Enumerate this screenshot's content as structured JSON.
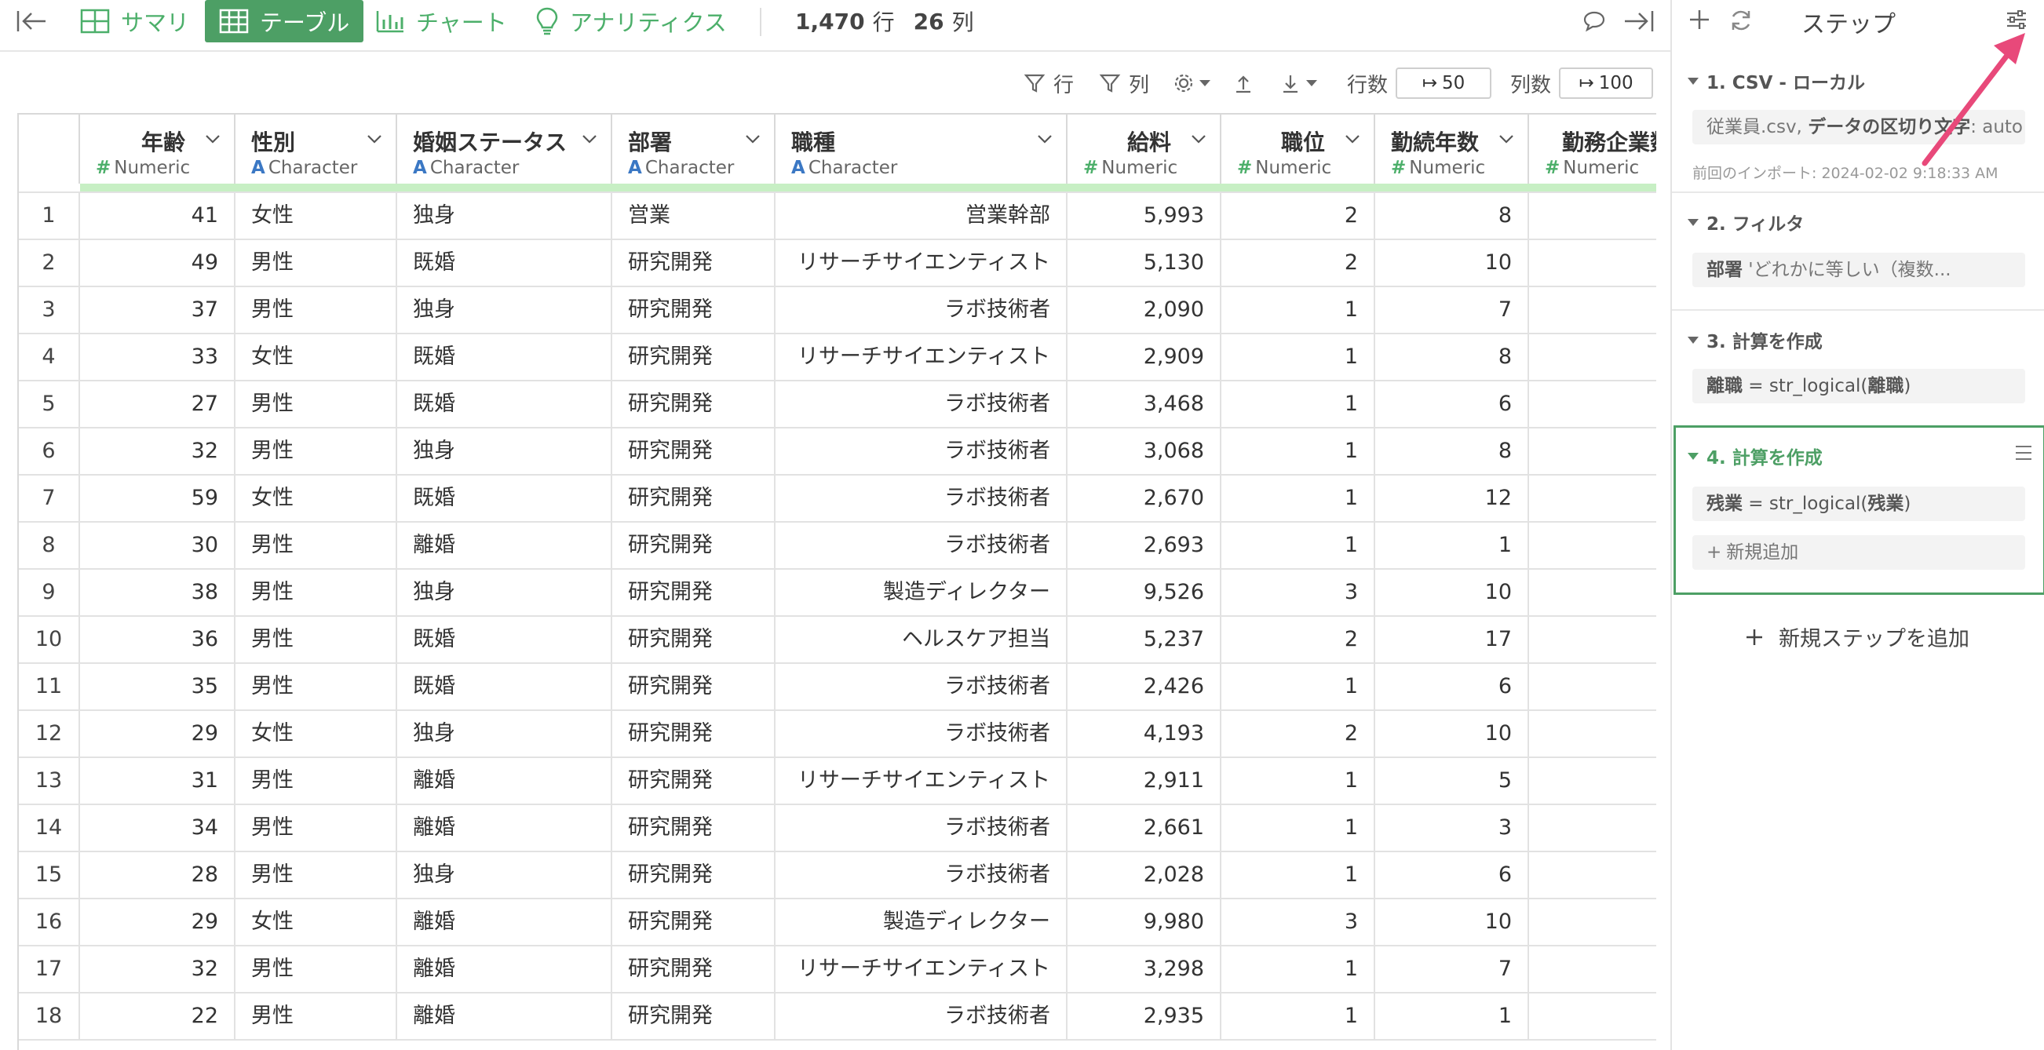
{
  "toolbar": {
    "tabs": [
      {
        "label": "サマリ",
        "icon": "summary-grid-icon",
        "active": false
      },
      {
        "label": "テーブル",
        "icon": "table-icon",
        "active": true
      },
      {
        "label": "チャート",
        "icon": "bar-chart-icon",
        "active": false
      },
      {
        "label": "アナリティクス",
        "icon": "lightbulb-icon",
        "active": false
      }
    ],
    "row_count": "1,470",
    "row_unit": "行",
    "col_count": "26",
    "col_unit": "列"
  },
  "options": {
    "row_filter": "行",
    "col_filter": "列",
    "rows_label": "行数",
    "rows_value": "50",
    "cols_label": "列数",
    "cols_value": "100"
  },
  "table": {
    "columns": [
      {
        "name": "年齢",
        "type": "Numeric"
      },
      {
        "name": "性別",
        "type": "Character"
      },
      {
        "name": "婚姻ステータス",
        "type": "Character"
      },
      {
        "name": "部署",
        "type": "Character"
      },
      {
        "name": "職種",
        "type": "Character"
      },
      {
        "name": "給料",
        "type": "Numeric"
      },
      {
        "name": "職位",
        "type": "Numeric"
      },
      {
        "name": "勤続年数",
        "type": "Numeric"
      },
      {
        "name": "勤務企業数",
        "type": "Numeric"
      }
    ],
    "rows": [
      [
        "1",
        "41",
        "女性",
        "独身",
        "営業",
        "営業幹部",
        "5,993",
        "2",
        "8"
      ],
      [
        "2",
        "49",
        "男性",
        "既婚",
        "研究開発",
        "リサーチサイエンティスト",
        "5,130",
        "2",
        "10"
      ],
      [
        "3",
        "37",
        "男性",
        "独身",
        "研究開発",
        "ラボ技術者",
        "2,090",
        "1",
        "7"
      ],
      [
        "4",
        "33",
        "女性",
        "既婚",
        "研究開発",
        "リサーチサイエンティスト",
        "2,909",
        "1",
        "8"
      ],
      [
        "5",
        "27",
        "男性",
        "既婚",
        "研究開発",
        "ラボ技術者",
        "3,468",
        "1",
        "6"
      ],
      [
        "6",
        "32",
        "男性",
        "独身",
        "研究開発",
        "ラボ技術者",
        "3,068",
        "1",
        "8"
      ],
      [
        "7",
        "59",
        "女性",
        "既婚",
        "研究開発",
        "ラボ技術者",
        "2,670",
        "1",
        "12"
      ],
      [
        "8",
        "30",
        "男性",
        "離婚",
        "研究開発",
        "ラボ技術者",
        "2,693",
        "1",
        "1"
      ],
      [
        "9",
        "38",
        "男性",
        "独身",
        "研究開発",
        "製造ディレクター",
        "9,526",
        "3",
        "10"
      ],
      [
        "10",
        "36",
        "男性",
        "既婚",
        "研究開発",
        "ヘルスケア担当",
        "5,237",
        "2",
        "17"
      ],
      [
        "11",
        "35",
        "男性",
        "既婚",
        "研究開発",
        "ラボ技術者",
        "2,426",
        "1",
        "6"
      ],
      [
        "12",
        "29",
        "女性",
        "独身",
        "研究開発",
        "ラボ技術者",
        "4,193",
        "2",
        "10"
      ],
      [
        "13",
        "31",
        "男性",
        "離婚",
        "研究開発",
        "リサーチサイエンティスト",
        "2,911",
        "1",
        "5"
      ],
      [
        "14",
        "34",
        "男性",
        "離婚",
        "研究開発",
        "ラボ技術者",
        "2,661",
        "1",
        "3"
      ],
      [
        "15",
        "28",
        "男性",
        "独身",
        "研究開発",
        "ラボ技術者",
        "2,028",
        "1",
        "6"
      ],
      [
        "16",
        "29",
        "女性",
        "離婚",
        "研究開発",
        "製造ディレクター",
        "9,980",
        "3",
        "10"
      ],
      [
        "17",
        "32",
        "男性",
        "離婚",
        "研究開発",
        "リサーチサイエンティスト",
        "3,298",
        "1",
        "7"
      ],
      [
        "18",
        "22",
        "男性",
        "離婚",
        "研究開発",
        "ラボ技術者",
        "2,935",
        "1",
        "1"
      ]
    ]
  },
  "panel": {
    "title": "ステップ",
    "steps": [
      {
        "title": "1. CSV - ローカル",
        "box_plain": "従業員.csv, ",
        "box_bold": "データの区切り文字",
        "box_rest": ": auto",
        "note": "前回のインポート: 2024-02-02 9:18:33 AM"
      },
      {
        "title": "2. フィルタ",
        "box_bold": "部署",
        "box_rest": " 'どれかに等しい（複数..."
      },
      {
        "title": "3. 計算を作成",
        "box_bold": "離職",
        "box_mid": " = str_logical(",
        "box_bold2": "離職",
        "box_end": ")"
      },
      {
        "title": "4. 計算を作成",
        "box_bold": "残業",
        "box_mid": " = str_logical(",
        "box_bold2": "残業",
        "box_end": ")",
        "add_label": "新規追加"
      }
    ],
    "add_step_label": "新規ステップを追加"
  },
  "colors": {
    "accent_green": "#4d9f65",
    "numeric_type": "#4caf6a",
    "character_type": "#3b78c4",
    "annotation_arrow": "#e8497a"
  }
}
